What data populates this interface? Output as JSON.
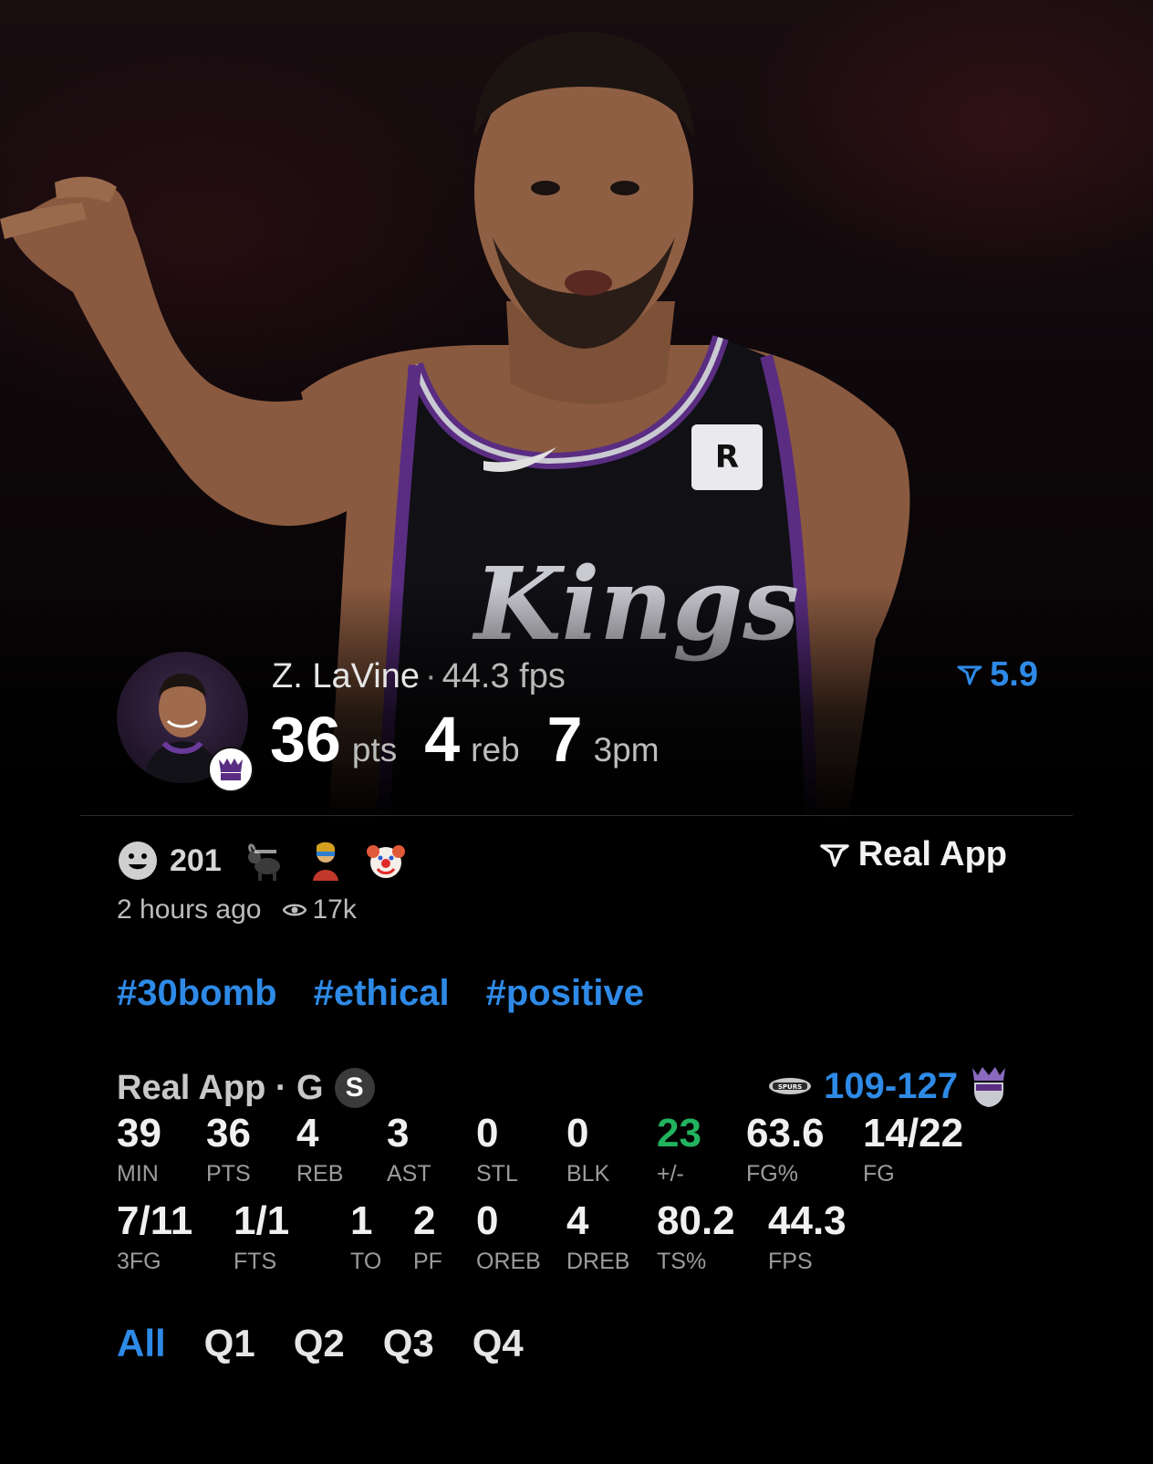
{
  "player": {
    "name": "Z. LaVine",
    "separator": "·",
    "fps": "44.3 fps",
    "pts_value": "36",
    "pts_unit": "pts",
    "reb_value": "4",
    "reb_unit": "reb",
    "threes_value": "7",
    "threes_unit": "3pm",
    "rating": "5.9"
  },
  "engagement": {
    "reaction_count": "201",
    "brand": "Real App",
    "time_ago": "2 hours ago",
    "views": "17k"
  },
  "tags": [
    "#30bomb",
    "#ethical",
    "#positive"
  ],
  "game": {
    "title": "Real App · G",
    "starter_badge": "S",
    "score_away": "109",
    "score_sep": "-",
    "score_home": "127"
  },
  "stats": {
    "row1": [
      {
        "value": "39",
        "label": "MIN"
      },
      {
        "value": "36",
        "label": "PTS"
      },
      {
        "value": "4",
        "label": "REB"
      },
      {
        "value": "3",
        "label": "AST"
      },
      {
        "value": "0",
        "label": "STL"
      },
      {
        "value": "0",
        "label": "BLK"
      },
      {
        "value": "23",
        "label": "+/-"
      },
      {
        "value": "63.6",
        "label": "FG%"
      },
      {
        "value": "14/22",
        "label": "FG"
      }
    ],
    "row2": [
      {
        "value": "7/11",
        "label": "3FG"
      },
      {
        "value": "1/1",
        "label": "FTS"
      },
      {
        "value": "1",
        "label": "TO"
      },
      {
        "value": "2",
        "label": "PF"
      },
      {
        "value": "0",
        "label": "OREB"
      },
      {
        "value": "4",
        "label": "DREB"
      },
      {
        "value": "80.2",
        "label": "TS%"
      },
      {
        "value": "44.3",
        "label": "FPS"
      }
    ],
    "plus_minus_color": "#22b35e"
  },
  "tabs": [
    "All",
    "Q1",
    "Q2",
    "Q3",
    "Q4"
  ],
  "colors": {
    "accent": "#2e8ae6",
    "positive": "#22b35e",
    "kings_purple": "#5a2d82"
  }
}
